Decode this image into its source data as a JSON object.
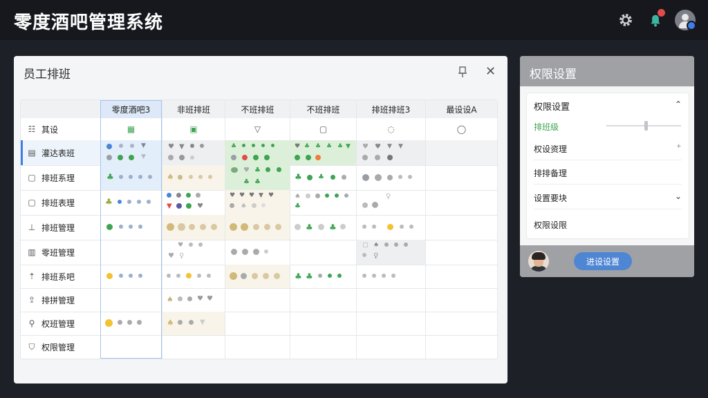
{
  "app": {
    "title": "零度酒吧管理系统"
  },
  "header_icons": {
    "settings": "gear-icon",
    "notifications": "bell-icon",
    "user": "user-avatar-icon"
  },
  "panel": {
    "title": "员工排班",
    "columns": [
      "零度酒吧3",
      "非班排班",
      "不班排班",
      "不班排班",
      "排班排班3",
      "最设设A"
    ],
    "rows": [
      {
        "label": "其设",
        "icon": "layout-icon"
      },
      {
        "label": "灌达表班",
        "icon": "document-icon"
      },
      {
        "label": "排班系理",
        "icon": "page-icon"
      },
      {
        "label": "排班表理",
        "icon": "page-icon"
      },
      {
        "label": "排班管理",
        "icon": "pin-icon"
      },
      {
        "label": "零班管理",
        "icon": "building-icon"
      },
      {
        "label": "排班系吧",
        "icon": "upload-icon"
      },
      {
        "label": "排拼管理",
        "icon": "export-icon"
      },
      {
        "label": "权班管理",
        "icon": "search-icon"
      },
      {
        "label": "权限管理",
        "icon": "shield-icon"
      }
    ]
  },
  "settings_panel": {
    "title": "权限设置",
    "card_title": "权限设置",
    "items": [
      "排班级",
      "权设资理",
      "排排备理",
      "设置要块",
      "权限设限"
    ],
    "save_label": "进设设置"
  },
  "colors": {
    "accent": "#3d7ee8",
    "green": "#3ea452",
    "red": "#e34b4b",
    "yellow": "#f2c230"
  }
}
